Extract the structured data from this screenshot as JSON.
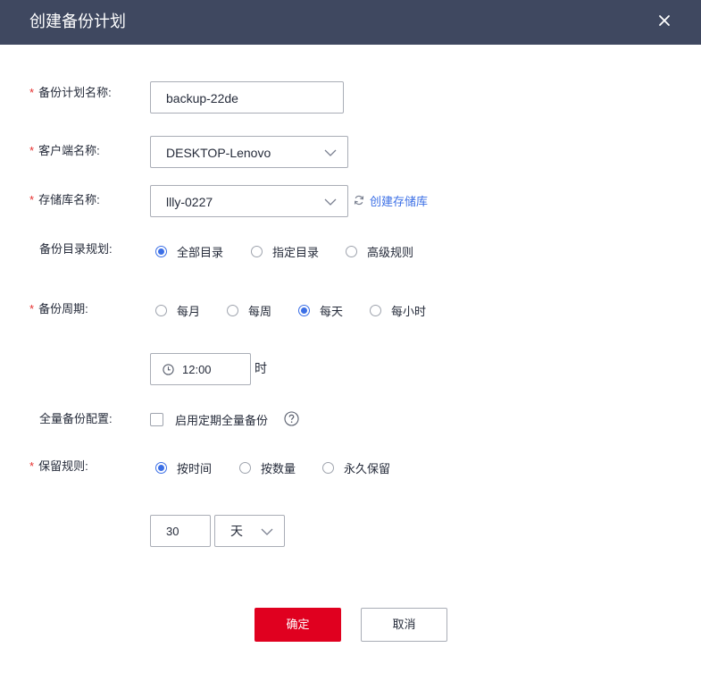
{
  "dialog": {
    "title": "创建备份计划"
  },
  "form": {
    "plan_name": {
      "label": "备份计划名称:",
      "required": true,
      "value": "backup-22de"
    },
    "client_name": {
      "label": "客户端名称:",
      "required": true,
      "value": "DESKTOP-Lenovo"
    },
    "repo_name": {
      "label": "存储库名称:",
      "required": true,
      "value": "llly-0227",
      "create_link": "创建存储库"
    },
    "dir_rule": {
      "label": "备份目录规划:",
      "options": [
        "全部目录",
        "指定目录",
        "高级规则"
      ],
      "selected": "全部目录"
    },
    "cycle": {
      "label": "备份周期:",
      "required": true,
      "options": [
        "每月",
        "每周",
        "每天",
        "每小时"
      ],
      "selected": "每天",
      "time": "12:00",
      "time_unit": "时"
    },
    "full_backup": {
      "label": "全量备份配置:",
      "checkbox_label": "启用定期全量备份",
      "checked": false
    },
    "retention": {
      "label": "保留规则:",
      "required": true,
      "options": [
        "按时间",
        "按数量",
        "永久保留"
      ],
      "selected": "按时间",
      "amount": "30",
      "unit": "天"
    }
  },
  "footer": {
    "confirm_label": "确定",
    "cancel_label": "取消"
  },
  "colors": {
    "header_bg": "#3f4860",
    "accent": "#3b6fe6",
    "required": "#e6302f",
    "primary_button": "#e0001f"
  }
}
